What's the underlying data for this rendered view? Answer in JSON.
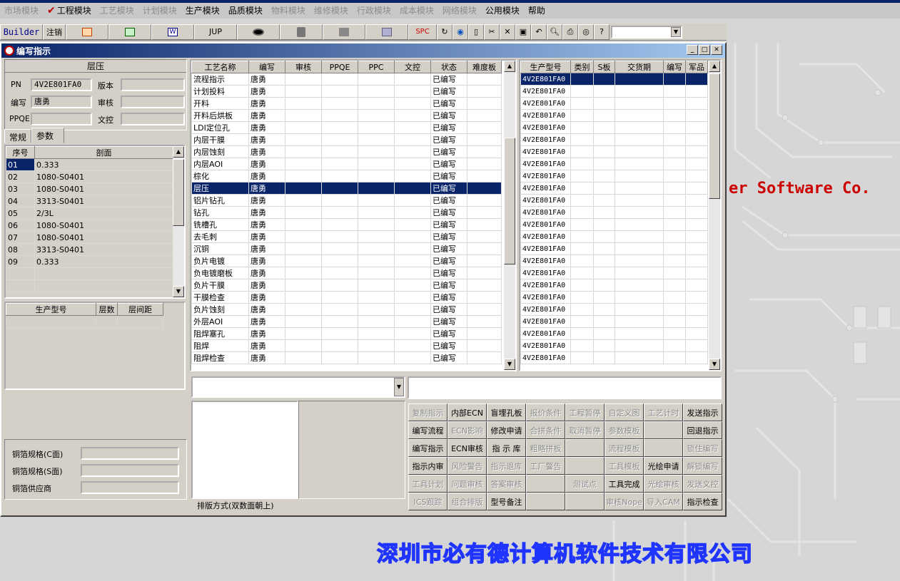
{
  "menu": [
    {
      "label": "市场模块",
      "enabled": false
    },
    {
      "label": "工程模块",
      "enabled": true,
      "checked": true
    },
    {
      "label": "工艺模块",
      "enabled": false
    },
    {
      "label": "计划模块",
      "enabled": false
    },
    {
      "label": "生产模块",
      "enabled": true
    },
    {
      "label": "品质模块",
      "enabled": true
    },
    {
      "label": "物料模块",
      "enabled": false
    },
    {
      "label": "维修模块",
      "enabled": false
    },
    {
      "label": "行政模块",
      "enabled": false
    },
    {
      "label": "成本模块",
      "enabled": false
    },
    {
      "label": "网络模块",
      "enabled": false
    },
    {
      "label": "公用模块",
      "enabled": true
    },
    {
      "label": "帮助",
      "enabled": true
    }
  ],
  "toolbar": {
    "builder": "Builder",
    "logout": "注销",
    "jup": "JUP",
    "spc": "SPC"
  },
  "window": {
    "title": "编写指示",
    "colors": {
      "titlebar": "#0a246a",
      "selected": "#0a246a"
    }
  },
  "left": {
    "section_title": "层压",
    "fields": {
      "pn_label": "PN",
      "pn_value": "4V2E801FA0",
      "version_label": "版本",
      "version_value": "",
      "author_label": "编写",
      "author_value": "唐勇",
      "review_label": "审核",
      "review_value": "",
      "ppqe_label": "PPQE",
      "ppqe_value": "",
      "doc_label": "文控",
      "doc_value": ""
    },
    "tabs": [
      "常规",
      "参数"
    ],
    "layer_grid": {
      "headers": [
        "序号",
        "剖面"
      ],
      "rows": [
        [
          "01",
          "0.333"
        ],
        [
          "02",
          "1080-S0401"
        ],
        [
          "03",
          "1080-S0401"
        ],
        [
          "04",
          "3313-S0401"
        ],
        [
          "05",
          "2/3L"
        ],
        [
          "06",
          "1080-S0401"
        ],
        [
          "07",
          "1080-S0401"
        ],
        [
          "08",
          "3313-S0401"
        ],
        [
          "09",
          "0.333"
        ]
      ]
    },
    "model_grid": {
      "headers": [
        "生产型号",
        "层数",
        "层间距"
      ]
    },
    "copper": {
      "c_label": "铜箔规格(C面)",
      "s_label": "铜箔规格(S面)",
      "supplier_label": "铜箔供应商"
    }
  },
  "process_grid": {
    "headers": [
      "工艺名称",
      "编写",
      "审核",
      "PPQE",
      "PPC",
      "文控",
      "状态",
      "难度板"
    ],
    "rows": [
      [
        "流程指示",
        "唐勇",
        "",
        "",
        "",
        "",
        "已编写",
        ""
      ],
      [
        "计划投料",
        "唐勇",
        "",
        "",
        "",
        "",
        "已编写",
        ""
      ],
      [
        "开料",
        "唐勇",
        "",
        "",
        "",
        "",
        "已编写",
        ""
      ],
      [
        "开料后烘板",
        "唐勇",
        "",
        "",
        "",
        "",
        "已编写",
        ""
      ],
      [
        "LDI定位孔",
        "唐勇",
        "",
        "",
        "",
        "",
        "已编写",
        ""
      ],
      [
        "内层干膜",
        "唐勇",
        "",
        "",
        "",
        "",
        "已编写",
        ""
      ],
      [
        "内层蚀刻",
        "唐勇",
        "",
        "",
        "",
        "",
        "已编写",
        ""
      ],
      [
        "内层AOI",
        "唐勇",
        "",
        "",
        "",
        "",
        "已编写",
        ""
      ],
      [
        "棕化",
        "唐勇",
        "",
        "",
        "",
        "",
        "已编写",
        ""
      ],
      [
        "层压",
        "唐勇",
        "",
        "",
        "",
        "",
        "已编写",
        ""
      ],
      [
        "铝片钻孔",
        "唐勇",
        "",
        "",
        "",
        "",
        "已编写",
        ""
      ],
      [
        "钻孔",
        "唐勇",
        "",
        "",
        "",
        "",
        "已编写",
        ""
      ],
      [
        "铣槽孔",
        "唐勇",
        "",
        "",
        "",
        "",
        "已编写",
        ""
      ],
      [
        "去毛刺",
        "唐勇",
        "",
        "",
        "",
        "",
        "已编写",
        ""
      ],
      [
        "沉铜",
        "唐勇",
        "",
        "",
        "",
        "",
        "已编写",
        ""
      ],
      [
        "负片电镀",
        "唐勇",
        "",
        "",
        "",
        "",
        "已编写",
        ""
      ],
      [
        "负电镀磨板",
        "唐勇",
        "",
        "",
        "",
        "",
        "已编写",
        ""
      ],
      [
        "负片干膜",
        "唐勇",
        "",
        "",
        "",
        "",
        "已编写",
        ""
      ],
      [
        "干膜检查",
        "唐勇",
        "",
        "",
        "",
        "",
        "已编写",
        ""
      ],
      [
        "负片蚀刻",
        "唐勇",
        "",
        "",
        "",
        "",
        "已编写",
        ""
      ],
      [
        "外层AOI",
        "唐勇",
        "",
        "",
        "",
        "",
        "已编写",
        ""
      ],
      [
        "阻焊塞孔",
        "唐勇",
        "",
        "",
        "",
        "",
        "已编写",
        ""
      ],
      [
        "阻焊",
        "唐勇",
        "",
        "",
        "",
        "",
        "已编写",
        ""
      ],
      [
        "阻焊检查",
        "唐勇",
        "",
        "",
        "",
        "",
        "已编写",
        ""
      ]
    ],
    "selected_index": 9
  },
  "right_grid": {
    "headers": [
      "生产型号",
      "类别",
      "S板",
      "交货期",
      "编写",
      "军品"
    ],
    "rows": [
      "4V2E801FA0",
      "4V2E801FA0",
      "4V2E801FA0",
      "4V2E801FA0",
      "4V2E801FA0",
      "4V2E801FA0",
      "4V2E801FA0",
      "4V2E801FA0",
      "4V2E801FA0",
      "4V2E801FA0",
      "4V2E801FA0",
      "4V2E801FA0",
      "4V2E801FA0",
      "4V2E801FA0",
      "4V2E801FA0",
      "4V2E801FA0",
      "4V2E801FA0",
      "4V2E801FA0",
      "4V2E801FA0",
      "4V2E801FA0",
      "4V2E801FA0",
      "4V2E801FA0",
      "4V2E801FA0",
      "4V2E801FA0"
    ]
  },
  "bottom": {
    "layout_label": "排版方式(双数面朝上)"
  },
  "actions": [
    [
      {
        "l": "复制指示",
        "e": false
      },
      {
        "l": "内部ECN",
        "e": true
      },
      {
        "l": "盲埋孔板",
        "e": true
      },
      {
        "l": "报价条件",
        "e": false
      },
      {
        "l": "工程暂停",
        "e": false
      },
      {
        "l": "自定义图",
        "e": false
      },
      {
        "l": "工艺计时",
        "e": false
      },
      {
        "l": "发送指示",
        "e": true
      }
    ],
    [
      {
        "l": "编写流程",
        "e": true
      },
      {
        "l": "ECN影响",
        "e": false
      },
      {
        "l": "修改申请",
        "e": true
      },
      {
        "l": "合拼条件",
        "e": false
      },
      {
        "l": "取消暂停",
        "e": false
      },
      {
        "l": "参数模板",
        "e": false
      },
      {
        "l": "",
        "e": false
      },
      {
        "l": "回退指示",
        "e": true
      }
    ],
    [
      {
        "l": "编写指示",
        "e": true
      },
      {
        "l": "ECN审核",
        "e": true
      },
      {
        "l": "指 示 库",
        "e": true
      },
      {
        "l": "粗略拼板",
        "e": false
      },
      {
        "l": "",
        "e": false
      },
      {
        "l": "流程模板",
        "e": false
      },
      {
        "l": "",
        "e": false
      },
      {
        "l": "锁住编写",
        "e": false
      }
    ],
    [
      {
        "l": "指示内审",
        "e": true
      },
      {
        "l": "风险警告",
        "e": false
      },
      {
        "l": "指示退库",
        "e": false
      },
      {
        "l": "工厂警告",
        "e": false
      },
      {
        "l": "",
        "e": false
      },
      {
        "l": "工具模板",
        "e": false
      },
      {
        "l": "光绘申请",
        "e": true
      },
      {
        "l": "解锁编写",
        "e": false
      }
    ],
    [
      {
        "l": "工具计划",
        "e": false
      },
      {
        "l": "问题审核",
        "e": false
      },
      {
        "l": "答案审核",
        "e": false
      },
      {
        "l": "",
        "e": false
      },
      {
        "l": "测试点",
        "e": false
      },
      {
        "l": "工具完成",
        "e": true
      },
      {
        "l": "光绘审核",
        "e": false
      },
      {
        "l": "发送文控",
        "e": false
      }
    ],
    [
      {
        "l": "ICS跟踪",
        "e": false
      },
      {
        "l": "组合排版",
        "e": false
      },
      {
        "l": "型号备注",
        "e": true
      },
      {
        "l": "",
        "e": false
      },
      {
        "l": "",
        "e": false
      },
      {
        "l": "审核Nope",
        "e": false
      },
      {
        "l": "导入CAM",
        "e": false
      },
      {
        "l": "指示检查",
        "e": true
      }
    ]
  ],
  "background": {
    "company_cn": "深圳市必有德计算机软件技术有限公司",
    "company_en": "er Software Co."
  }
}
